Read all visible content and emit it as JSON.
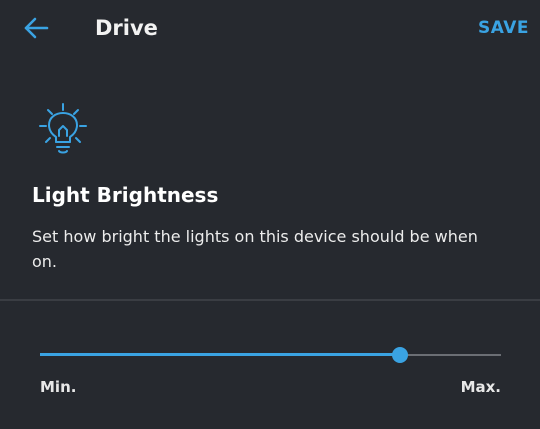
{
  "header": {
    "back_icon": "arrow-left-icon",
    "title": "Drive",
    "save_label": "SAVE"
  },
  "setting": {
    "icon": "lightbulb-icon",
    "heading": "Light Brightness",
    "description": "Set how bright the lights on this device should be when on."
  },
  "slider": {
    "value_fraction": 0.78,
    "min_label": "Min.",
    "max_label": "Max."
  },
  "colors": {
    "accent": "#3aa3e3",
    "background": "#26292f",
    "track": "#6b6e74"
  }
}
